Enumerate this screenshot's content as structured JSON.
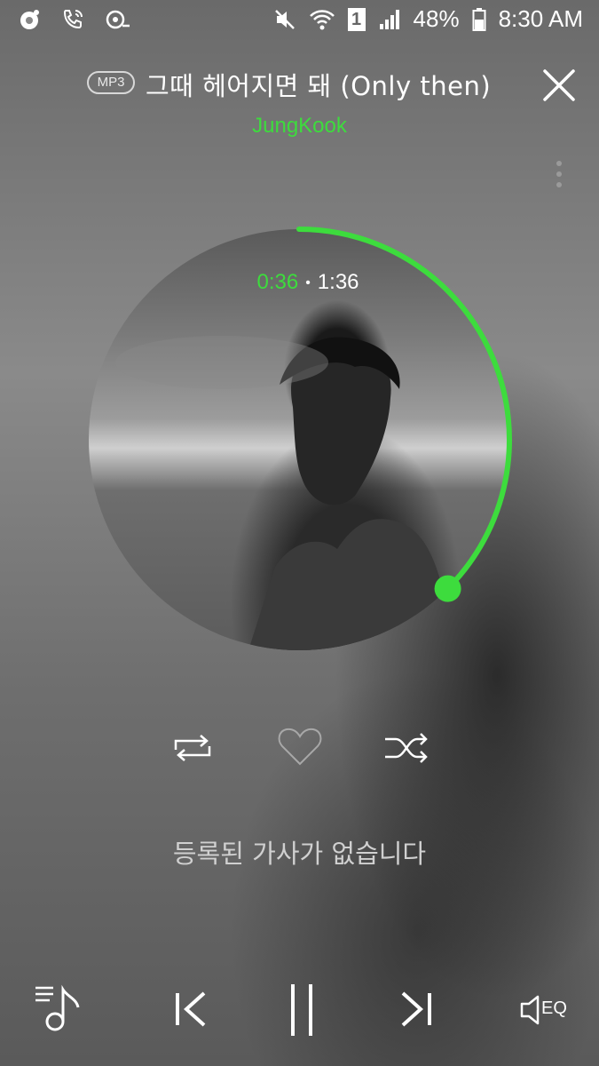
{
  "status_bar": {
    "battery_percent": "48%",
    "time": "8:30 AM",
    "sim_slot": "1"
  },
  "player": {
    "format_badge": "MP3",
    "title": "그때 헤어지면 돼 (Only then)",
    "artist": "JungKook",
    "elapsed": "0:36",
    "duration": "1:36",
    "progress_fraction": 0.375,
    "lyrics_message": "등록된 가사가 없습니다"
  },
  "controls": {
    "eq_label": "EQ"
  },
  "colors": {
    "accent": "#3ddc3d",
    "text": "#ffffff"
  },
  "icons": [
    "music-app-icon",
    "phone-call-icon",
    "voicemail-icon",
    "mute-icon",
    "wifi-icon",
    "signal-icon",
    "battery-icon",
    "close-icon",
    "more-vertical-icon",
    "repeat-icon",
    "heart-icon",
    "shuffle-icon",
    "playlist-icon",
    "previous-icon",
    "pause-icon",
    "next-icon",
    "equalizer-icon"
  ]
}
